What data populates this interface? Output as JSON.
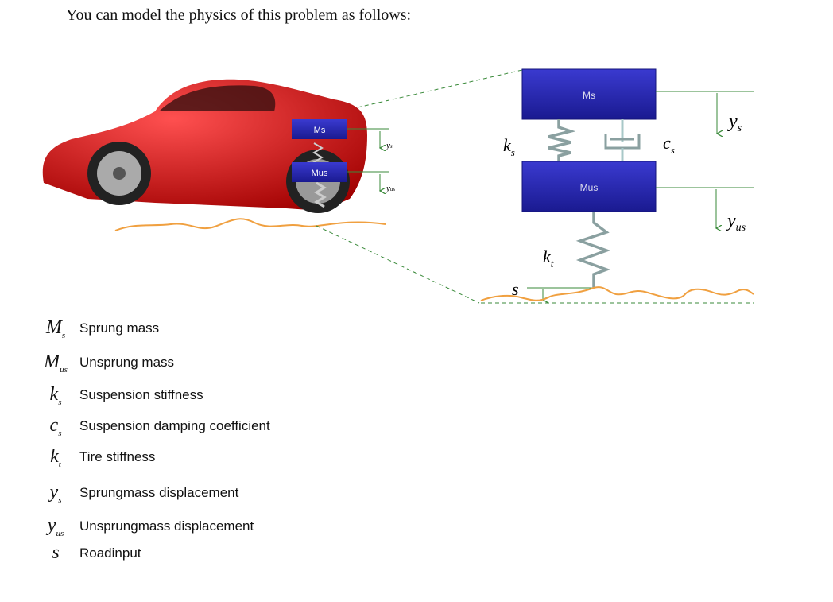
{
  "heading": "You can model the physics of this problem as follows:",
  "car_figure": {
    "mass_top_label": "Ms",
    "mass_bottom_label": "Mus",
    "disp_top": {
      "base": "y",
      "sub": "s"
    },
    "disp_bottom": {
      "base": "y",
      "sub": "us"
    }
  },
  "model_diagram": {
    "sprung_mass_label": "Ms",
    "unsprung_mass_label": "Mus",
    "ks": {
      "base": "k",
      "sub": "s"
    },
    "cs": {
      "base": "c",
      "sub": "s"
    },
    "kt": {
      "base": "k",
      "sub": "t"
    },
    "ys": {
      "base": "y",
      "sub": "s"
    },
    "yus": {
      "base": "y",
      "sub": "us"
    },
    "s": "s"
  },
  "legend": [
    {
      "base": "M",
      "sub": "s",
      "text": "Sprung mass"
    },
    {
      "base": "M",
      "sub": "us",
      "text": "Unsprung mass"
    },
    {
      "base": "k",
      "sub": "s",
      "text": "Suspension stiffness"
    },
    {
      "base": "c",
      "sub": "s",
      "text": "Suspension damping coefficient"
    },
    {
      "base": "k",
      "sub": "t",
      "text": "Tire stiffness"
    },
    {
      "base": "y",
      "sub": "s",
      "text": "Sprungmass displacement"
    },
    {
      "base": "y",
      "sub": "us",
      "text": "Unsprungmass displacement"
    },
    {
      "base": "s",
      "sub": "",
      "text": "Roadinput"
    }
  ],
  "colors": {
    "mass": "#2a2aa8",
    "car": "#d01010",
    "road": "#f0a040",
    "arrow": "#3a8a3a",
    "spring": "#8aa0a0"
  }
}
